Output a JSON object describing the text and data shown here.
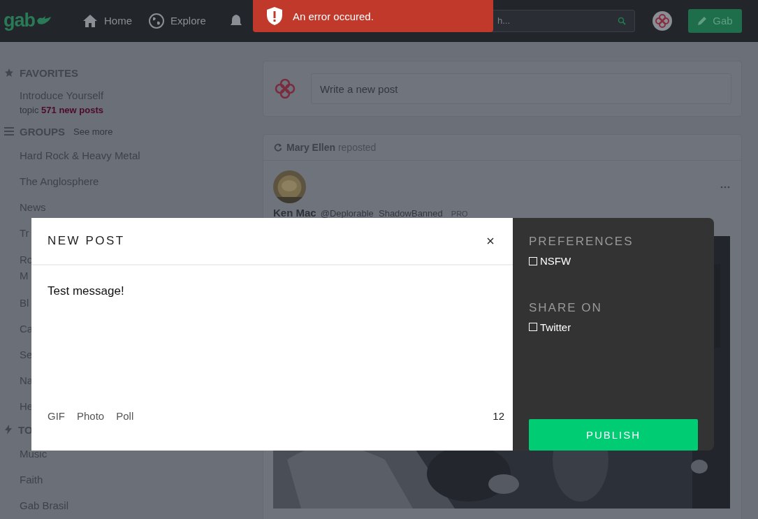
{
  "navbar": {
    "logo": "gab",
    "links": [
      {
        "kind": "home",
        "label": "Home"
      },
      {
        "kind": "explore",
        "label": "Explore"
      }
    ],
    "search": {
      "placeholder": "h..."
    },
    "gab_button": "Gab"
  },
  "toast": {
    "message": "An error occured."
  },
  "sidebar": {
    "sections": [
      {
        "kind": "favorites",
        "title": "FAVORITES",
        "items": [
          {
            "label": "Introduce Yourself",
            "meta": "topic",
            "count": "571 new posts"
          }
        ]
      },
      {
        "kind": "groups",
        "title": "GROUPS",
        "link": "See more",
        "items": [
          {
            "label": "Hard Rock & Heavy Metal"
          },
          {
            "label": "The Anglosphere"
          },
          {
            "label": "News"
          },
          {
            "label": "Tr"
          },
          {
            "lines": [
              "Ro",
              "M"
            ]
          },
          {
            "label": "Bl"
          },
          {
            "label": "Ca"
          },
          {
            "label": "Se"
          },
          {
            "label": "Na"
          },
          {
            "label": "He"
          }
        ]
      },
      {
        "kind": "topics",
        "title": "TO",
        "items": [
          {
            "label": "Music"
          },
          {
            "label": "Faith"
          },
          {
            "label": "Gab Brasil"
          }
        ]
      }
    ]
  },
  "composer": {
    "placeholder": "Write a new post"
  },
  "post": {
    "reposter": "Mary Ellen",
    "repost_text": "reposted",
    "author": "Ken Mac",
    "handle": "@Deplorable_ShadowBanned",
    "badge": "PRO"
  },
  "modal": {
    "title": "NEW POST",
    "text": "Test message!",
    "attachments": [
      "GIF",
      "Photo",
      "Poll"
    ],
    "count": "12",
    "sections": [
      {
        "title": "PREFERENCES",
        "options": [
          {
            "label": "NSFW",
            "checked": false
          }
        ]
      },
      {
        "title": "SHARE ON",
        "options": [
          {
            "label": "Twitter",
            "checked": false
          }
        ]
      }
    ],
    "publish": "PUBLISH"
  }
}
